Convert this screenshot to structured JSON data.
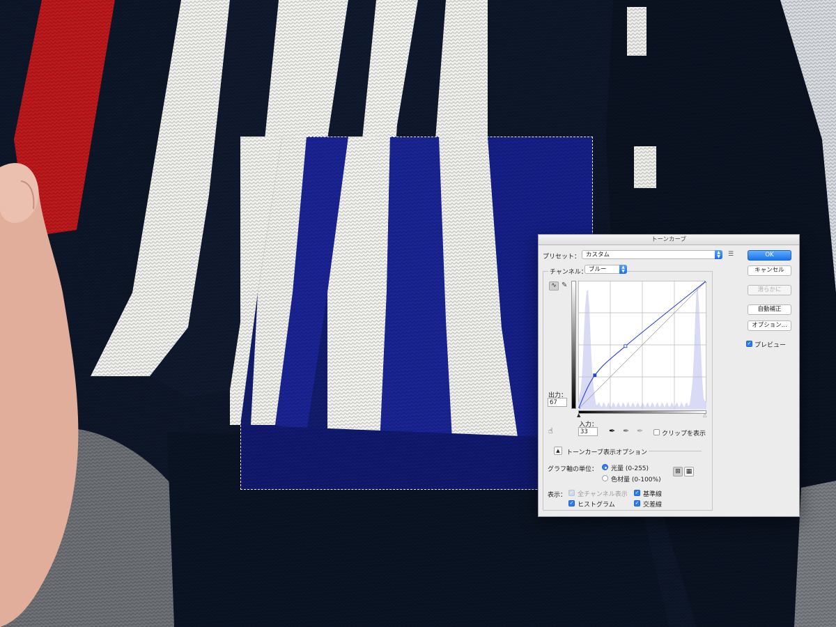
{
  "dialog": {
    "title": "トーンカーブ",
    "preset_label": "プリセット：",
    "preset_value": "カスタム",
    "channel_label": "チャンネル：",
    "channel_value": "ブルー",
    "buttons": {
      "ok": "OK",
      "cancel": "キャンセル",
      "smooth": "滑らかに",
      "auto": "自動補正",
      "options": "オプション..."
    },
    "preview_label": "プレビュー",
    "preview_checked": true,
    "output_label": "出力：",
    "output_value": "67",
    "input_label": "入力：",
    "input_value": "33",
    "clip_label": "クリップを表示",
    "clip_checked": false,
    "display_options_label": "トーンカーブ表示オプション",
    "units_label": "グラフ軸の単位：",
    "unit_light": "光量 (0-255)",
    "unit_pigment": "色材量 (0-100%)",
    "unit_selected": "light",
    "show_label": "表示：",
    "show_all_channels": "全チャンネル表示",
    "show_baseline": "基準線",
    "show_histogram": "ヒストグラム",
    "show_intersection": "交差線",
    "colors": {
      "accent": "#1f6fe8",
      "curve": "#2a3fd6",
      "histogram": "#d9daf6"
    }
  },
  "curve": {
    "points": [
      [
        0,
        0
      ],
      [
        33,
        67
      ],
      [
        94,
        125
      ],
      [
        255,
        255
      ]
    ]
  },
  "icons": {
    "curve_tool": "curve-tool-icon",
    "pencil_tool": "pencil-icon",
    "preset_menu": "preset-options-icon",
    "on_image_adjust": "hand-adjust-icon",
    "black_eyedropper": "black-point-eyedropper-icon",
    "gray_eyedropper": "gray-point-eyedropper-icon",
    "white_eyedropper": "white-point-eyedropper-icon",
    "simple_grid": "simple-grid-icon",
    "detailed_grid": "detailed-grid-icon"
  }
}
